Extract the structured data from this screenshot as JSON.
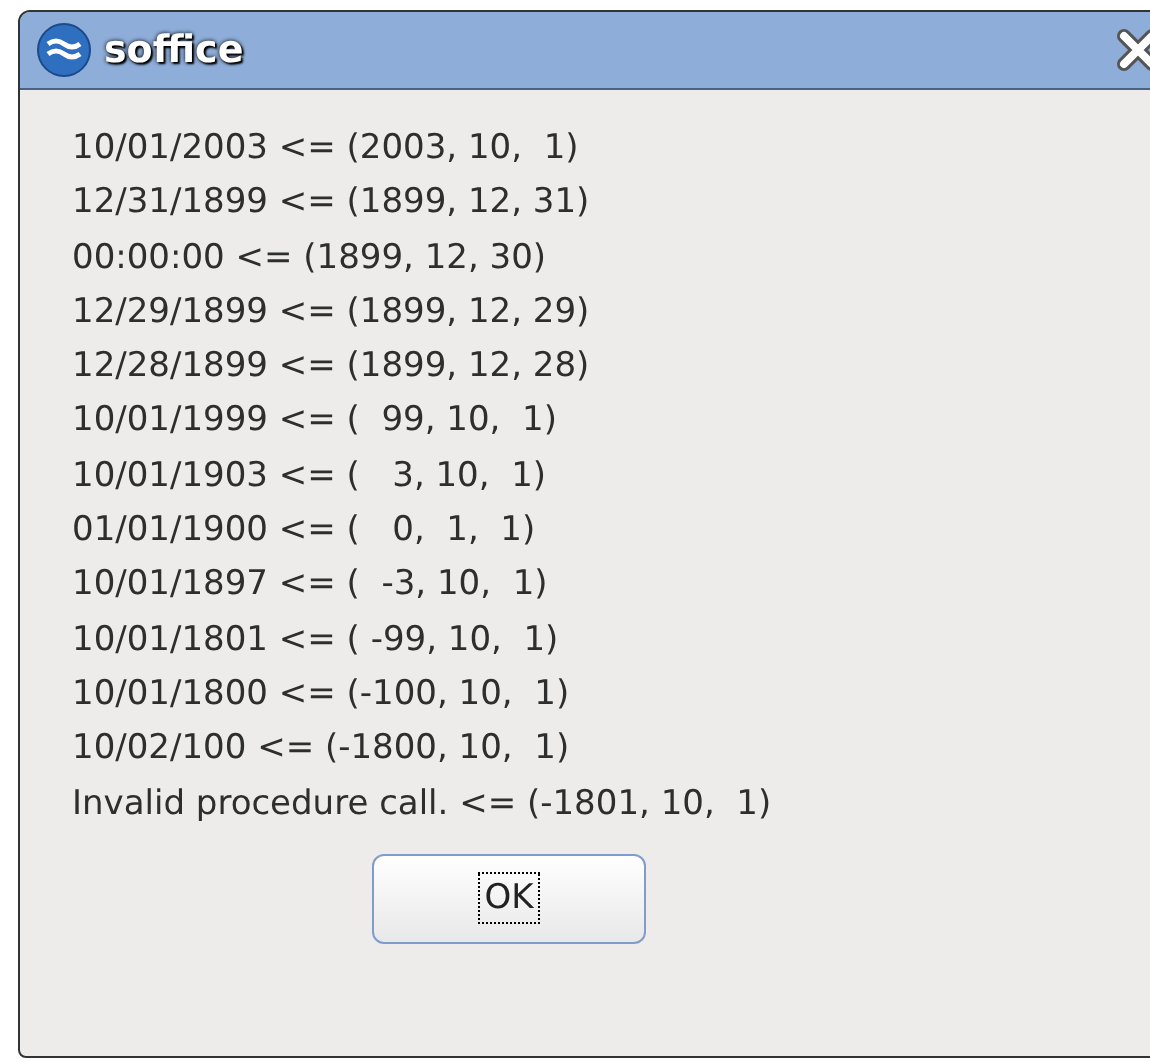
{
  "window": {
    "title": "soffice"
  },
  "message_lines": [
    "10/01/2003 <= (2003, 10,  1)",
    "12/31/1899 <= (1899, 12, 31)",
    "00:00:00 <= (1899, 12, 30)",
    "12/29/1899 <= (1899, 12, 29)",
    "12/28/1899 <= (1899, 12, 28)",
    "10/01/1999 <= (  99, 10,  1)",
    "10/01/1903 <= (   3, 10,  1)",
    "01/01/1900 <= (   0,  1,  1)",
    "10/01/1897 <= (  -3, 10,  1)",
    "10/01/1801 <= ( -99, 10,  1)",
    "10/01/1800 <= (-100, 10,  1)",
    "10/02/100 <= (-1800, 10,  1)",
    "Invalid procedure call. <= (-1801, 10,  1)"
  ],
  "buttons": [
    {
      "label": "OK",
      "focused": true
    }
  ]
}
